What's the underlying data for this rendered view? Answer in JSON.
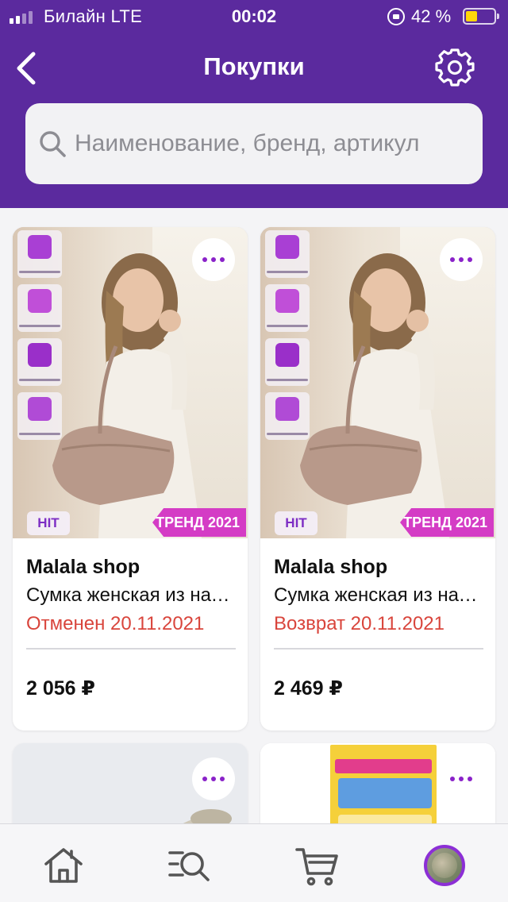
{
  "status_bar": {
    "carrier": "Билайн  LTE",
    "time": "00:02",
    "battery_percent_text": "42 %",
    "battery_level": 0.42,
    "signal_bars_active": 2,
    "signal_bars_total": 4
  },
  "header": {
    "title": "Покупки",
    "back_icon": "chevron-left-icon",
    "settings_icon": "gear-icon"
  },
  "search": {
    "placeholder": "Наименование, бренд, артикул",
    "value": "",
    "icon": "search-icon"
  },
  "purchases": [
    {
      "brand": "Malala shop",
      "name": "Сумка женская из натуральной кожи",
      "status": "Отменен 20.11.2021",
      "price": "2 056 ₽",
      "badge_left": "HIT",
      "badge_right": "ТРЕНД 2021",
      "more_icon": "more-dots-icon"
    },
    {
      "brand": "Malala shop",
      "name": "Сумка женская из натуральной кожи",
      "status": "Возврат 20.11.2021",
      "price": "2 469 ₽",
      "badge_left": "HIT",
      "badge_right": "ТРЕНД 2021",
      "more_icon": "more-dots-icon"
    }
  ],
  "tabbar": {
    "items": [
      {
        "icon": "home-icon"
      },
      {
        "icon": "catalog-search-icon"
      },
      {
        "icon": "cart-icon"
      },
      {
        "icon": "profile-avatar-icon"
      }
    ]
  },
  "colors": {
    "brand_purple": "#5b2a9e",
    "status_red": "#d9453c",
    "accent_violet": "#8a22c9",
    "battery_yellow": "#ffd60a"
  }
}
